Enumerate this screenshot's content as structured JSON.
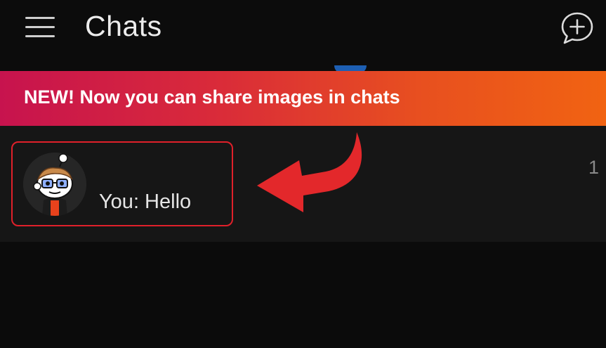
{
  "header": {
    "title": "Chats",
    "menu_icon": "hamburger-menu-icon",
    "new_chat_icon": "new-chat-plus-icon"
  },
  "banner": {
    "text": "NEW! Now you can share images in chats",
    "gradient_start": "#c7134e",
    "gradient_end": "#f16312"
  },
  "chats": [
    {
      "avatar_icon": "snoo-avatar-icon",
      "preview": "You: Hello",
      "count": "1"
    }
  ],
  "annotation": {
    "color": "#e0202a",
    "arrow_icon": "curved-arrow-icon"
  }
}
